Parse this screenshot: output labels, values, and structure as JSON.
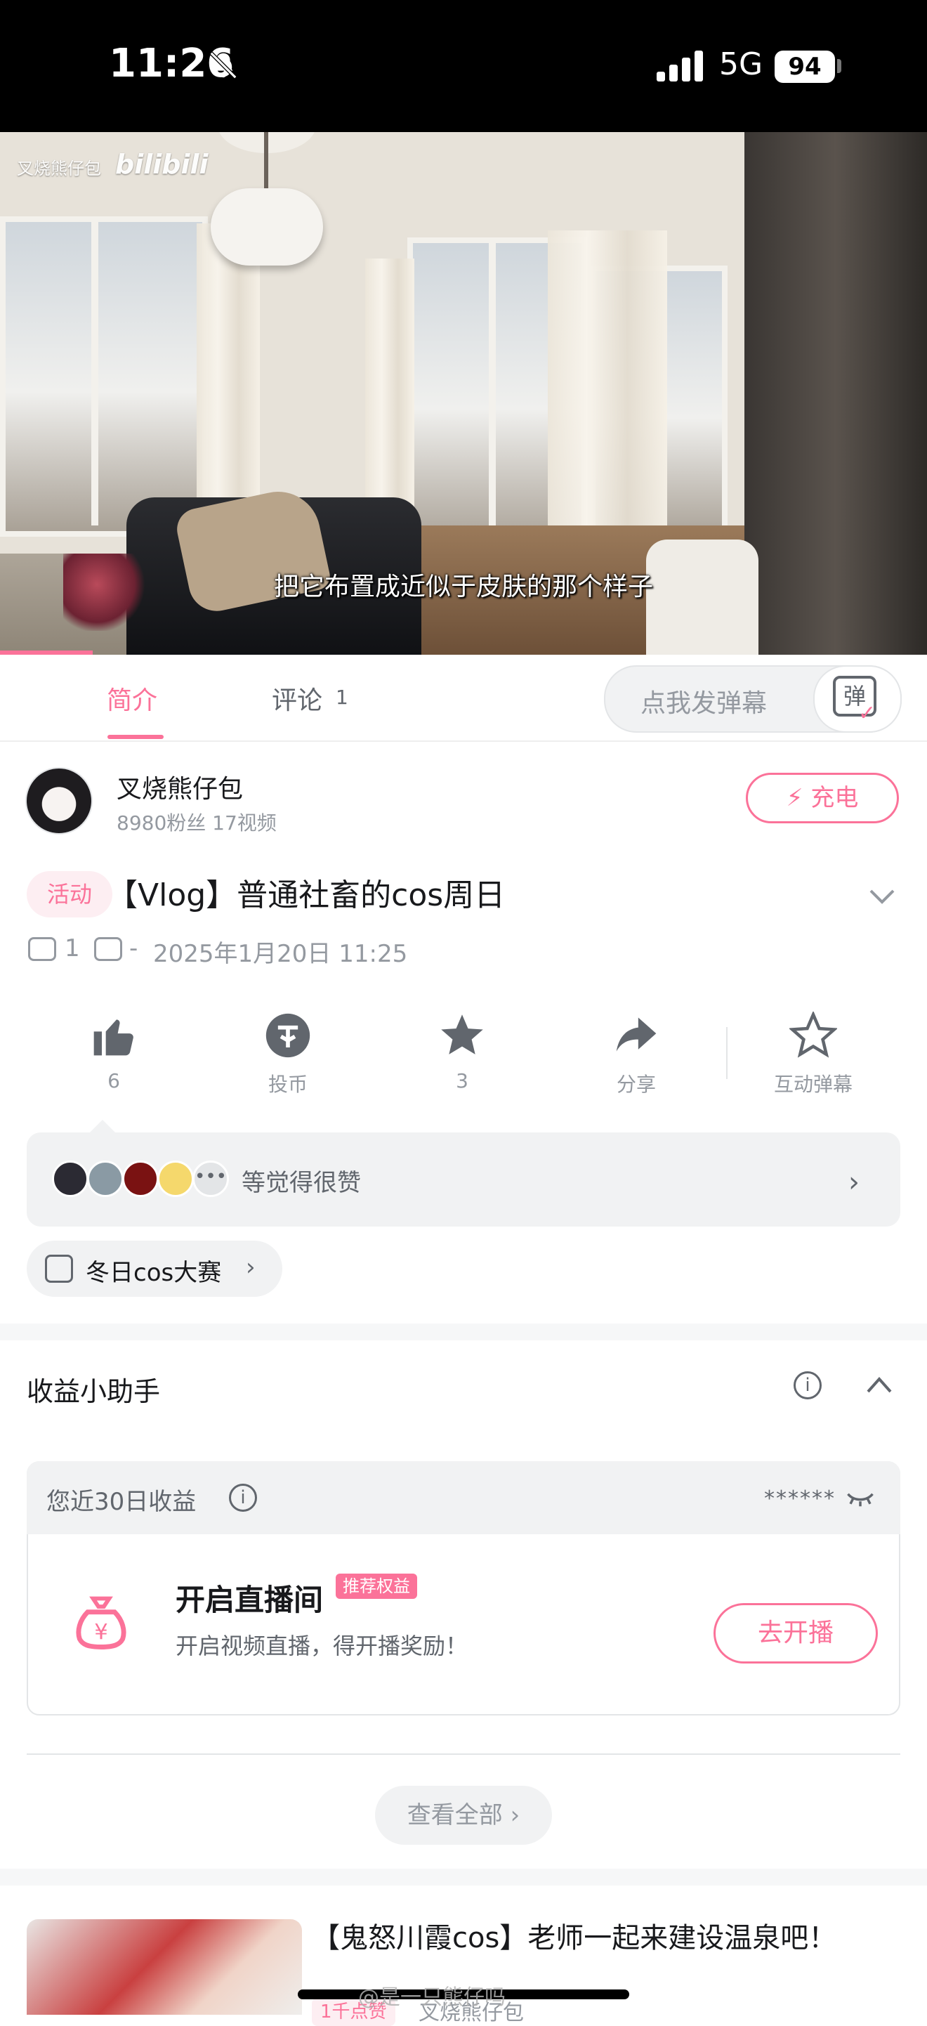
{
  "status_bar": {
    "time": "11:26",
    "network": "5G",
    "battery": "94"
  },
  "video": {
    "watermark_user": "叉烧熊仔包",
    "watermark_logo": "bilibili",
    "subtitle": "把它布置成近似于皮肤的那个样子"
  },
  "tabs": {
    "intro": "简介",
    "comments": "评论",
    "comments_count": "1",
    "danmaku_placeholder": "点我发弹幕",
    "danmaku_icon_label": "弹"
  },
  "uploader": {
    "name": "叉烧熊仔包",
    "stats": "8980粉丝  17视频",
    "charge_label": "充电"
  },
  "video_info": {
    "badge": "活动",
    "title": "【Vlog】普通社畜的cos周日",
    "plays": "1",
    "danmaku_count": "-",
    "date": "2025年1月20日 11:25"
  },
  "actions": [
    {
      "label": "6",
      "icon": "thumbs-up-icon"
    },
    {
      "label": "投币",
      "icon": "coin-icon"
    },
    {
      "label": "3",
      "icon": "star-icon"
    },
    {
      "label": "分享",
      "icon": "share-icon"
    },
    {
      "label": "互动弹幕",
      "icon": "sparkle-star-icon"
    }
  ],
  "liked_by": {
    "text": "等觉得很赞"
  },
  "topic": {
    "label": "冬日cos大赛"
  },
  "earnings": {
    "title": "收益小助手",
    "recent_label": "您近30日收益",
    "hidden_value": "******",
    "live_title": "开启直播间",
    "live_tag": "推荐权益",
    "live_desc": "开启视频直播，得开播奖励！",
    "go_live": "去开播",
    "view_all": "查看全部"
  },
  "recommended": {
    "title": "【鬼怒川霞cos】老师一起来建设温泉吧！",
    "badge": "1千点赞",
    "uploader": "叉烧熊仔包"
  },
  "overlay": {
    "weibo_watermark": "@是一只熊仔吗"
  },
  "colors": {
    "accent": "#fb7299",
    "text_primary": "#18191c",
    "text_secondary": "#61666d",
    "text_muted": "#9499a0"
  }
}
